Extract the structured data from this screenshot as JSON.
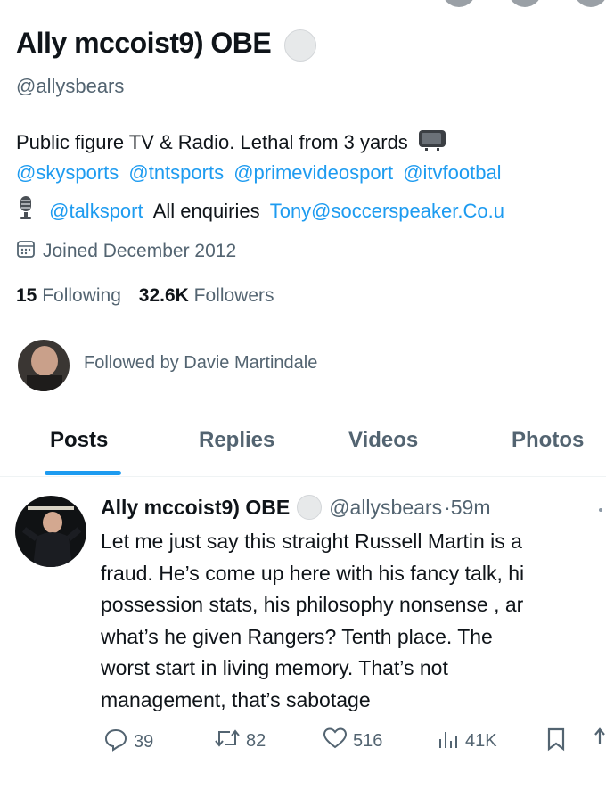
{
  "profile": {
    "name": "Ally mccoist9) OBE",
    "handle": "@allysbears",
    "bio_line1_text": "Public figure TV & Radio. Lethal from 3 yards",
    "bio_mentions": [
      "@skysports",
      "@tntsports",
      "@primevideosport",
      "@itvfootbal"
    ],
    "bio_line3_mention": "@talksport",
    "bio_line3_text": "All enquiries",
    "bio_line3_email": "Tony@soccerspeaker.Co.u",
    "joined": "Joined December 2012",
    "following_count": "15",
    "following_label": "Following",
    "followers_count": "32.6K",
    "followers_label": "Followers",
    "followed_by": "Followed by Davie Martindale"
  },
  "tabs": [
    {
      "label": "Posts",
      "active": true
    },
    {
      "label": "Replies",
      "active": false
    },
    {
      "label": "Videos",
      "active": false
    },
    {
      "label": "Photos",
      "active": false
    }
  ],
  "tweet": {
    "name": "Ally mccoist9) OBE",
    "handle": "@allysbears",
    "time": "·59m",
    "lines": [
      "Let me just say this straight  Russell Martin is a",
      "fraud. He’s come up here with his fancy talk, hi",
      "possession stats, his philosophy nonsense , ar",
      "what’s he given Rangers? Tenth place. The",
      "worst start in living memory. That’s not",
      "management, that’s sabotage"
    ],
    "replies": "39",
    "reposts": "82",
    "likes": "516",
    "views": "41K"
  },
  "colors": {
    "accent": "#1d9bf0",
    "text": "#0f1419",
    "muted": "#536471"
  },
  "icons": [
    "tv-icon",
    "microphone-icon",
    "calendar-icon",
    "reply-icon",
    "repost-icon",
    "like-icon",
    "views-icon",
    "bookmark-icon",
    "share-icon"
  ]
}
